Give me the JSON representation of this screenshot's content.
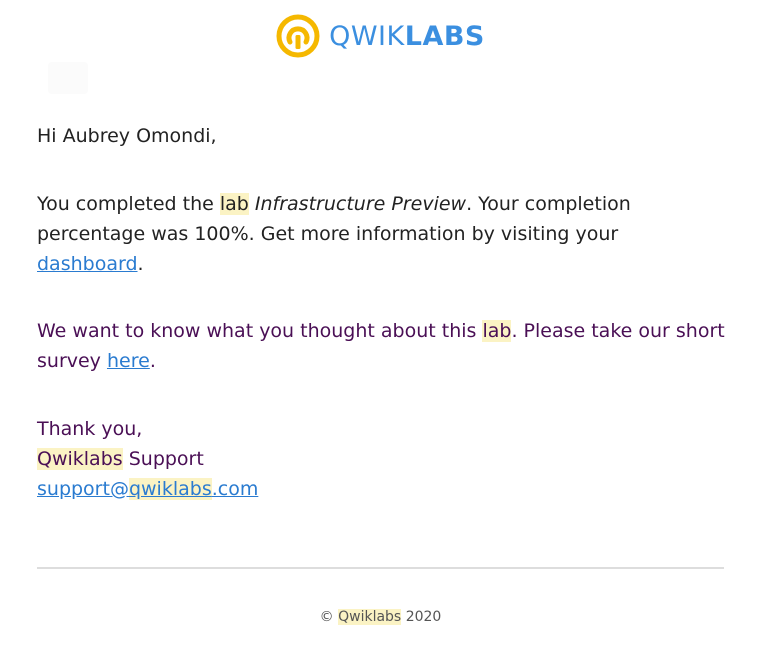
{
  "header": {
    "logo_text_light": "QWIK",
    "logo_text_bold": "LABS",
    "brand_colors": {
      "logo_mark": "#f5b800",
      "logo_text": "#3b8fe0"
    }
  },
  "email": {
    "greeting": "Hi Aubrey Omondi,",
    "completion": {
      "before": "You completed the ",
      "lab_word": "lab",
      "space": " ",
      "lab_name": "Infrastructure Preview",
      "middle": ". Your completion percentage was 100%. Get more information by visiting your ",
      "link_text": "dashboard",
      "after": "."
    },
    "survey": {
      "before": "We want to know what you thought about this ",
      "lab_word": "lab",
      "middle": ". Please take our short survey ",
      "link_text": "here",
      "after": "."
    },
    "signoff": {
      "thanks": "Thank you,",
      "brand": "Qwiklabs",
      "team": " Support",
      "email_user": "support@",
      "email_brand": "qwiklabs",
      "email_domain": ".com"
    }
  },
  "footer": {
    "copyright_symbol": "©",
    "brand": "Qwiklabs",
    "year": "2020"
  },
  "colors": {
    "link": "#2a7bd0",
    "highlight": "#fbf3c4",
    "survey_text": "#4a0f55",
    "divider": "#dddddd"
  }
}
